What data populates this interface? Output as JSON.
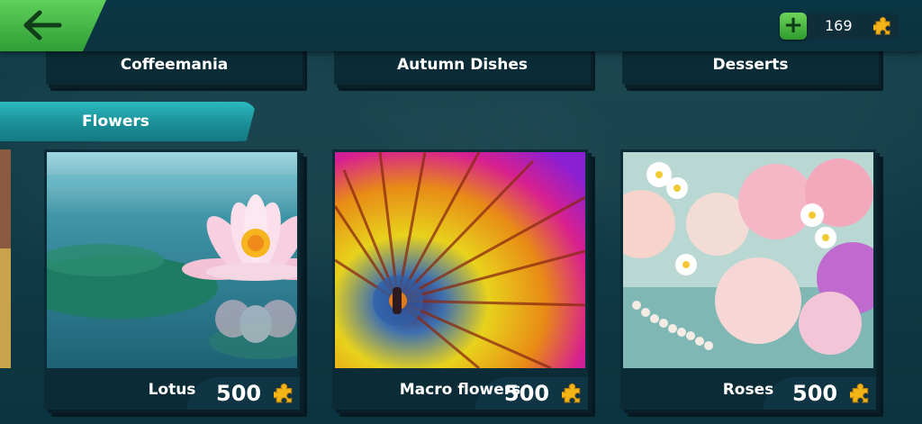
{
  "header": {
    "coins": "169"
  },
  "categories": [
    {
      "label": "Coffeemania"
    },
    {
      "label": "Autumn Dishes"
    },
    {
      "label": "Desserts"
    }
  ],
  "section": {
    "title": "Flowers"
  },
  "puzzles": [
    {
      "title": "Lotus",
      "pieces": "500"
    },
    {
      "title": "Macro flowers",
      "pieces": "500"
    },
    {
      "title": "Roses",
      "pieces": "500"
    }
  ],
  "icons": {
    "back": "arrow-left-icon",
    "add": "plus-icon",
    "piece": "puzzle-piece-icon"
  },
  "colors": {
    "accent_green": "#3fb543",
    "section_teal": "#1f9ea6",
    "card_bg": "#0b2b36",
    "puzzle_gold": "#f2b417"
  }
}
